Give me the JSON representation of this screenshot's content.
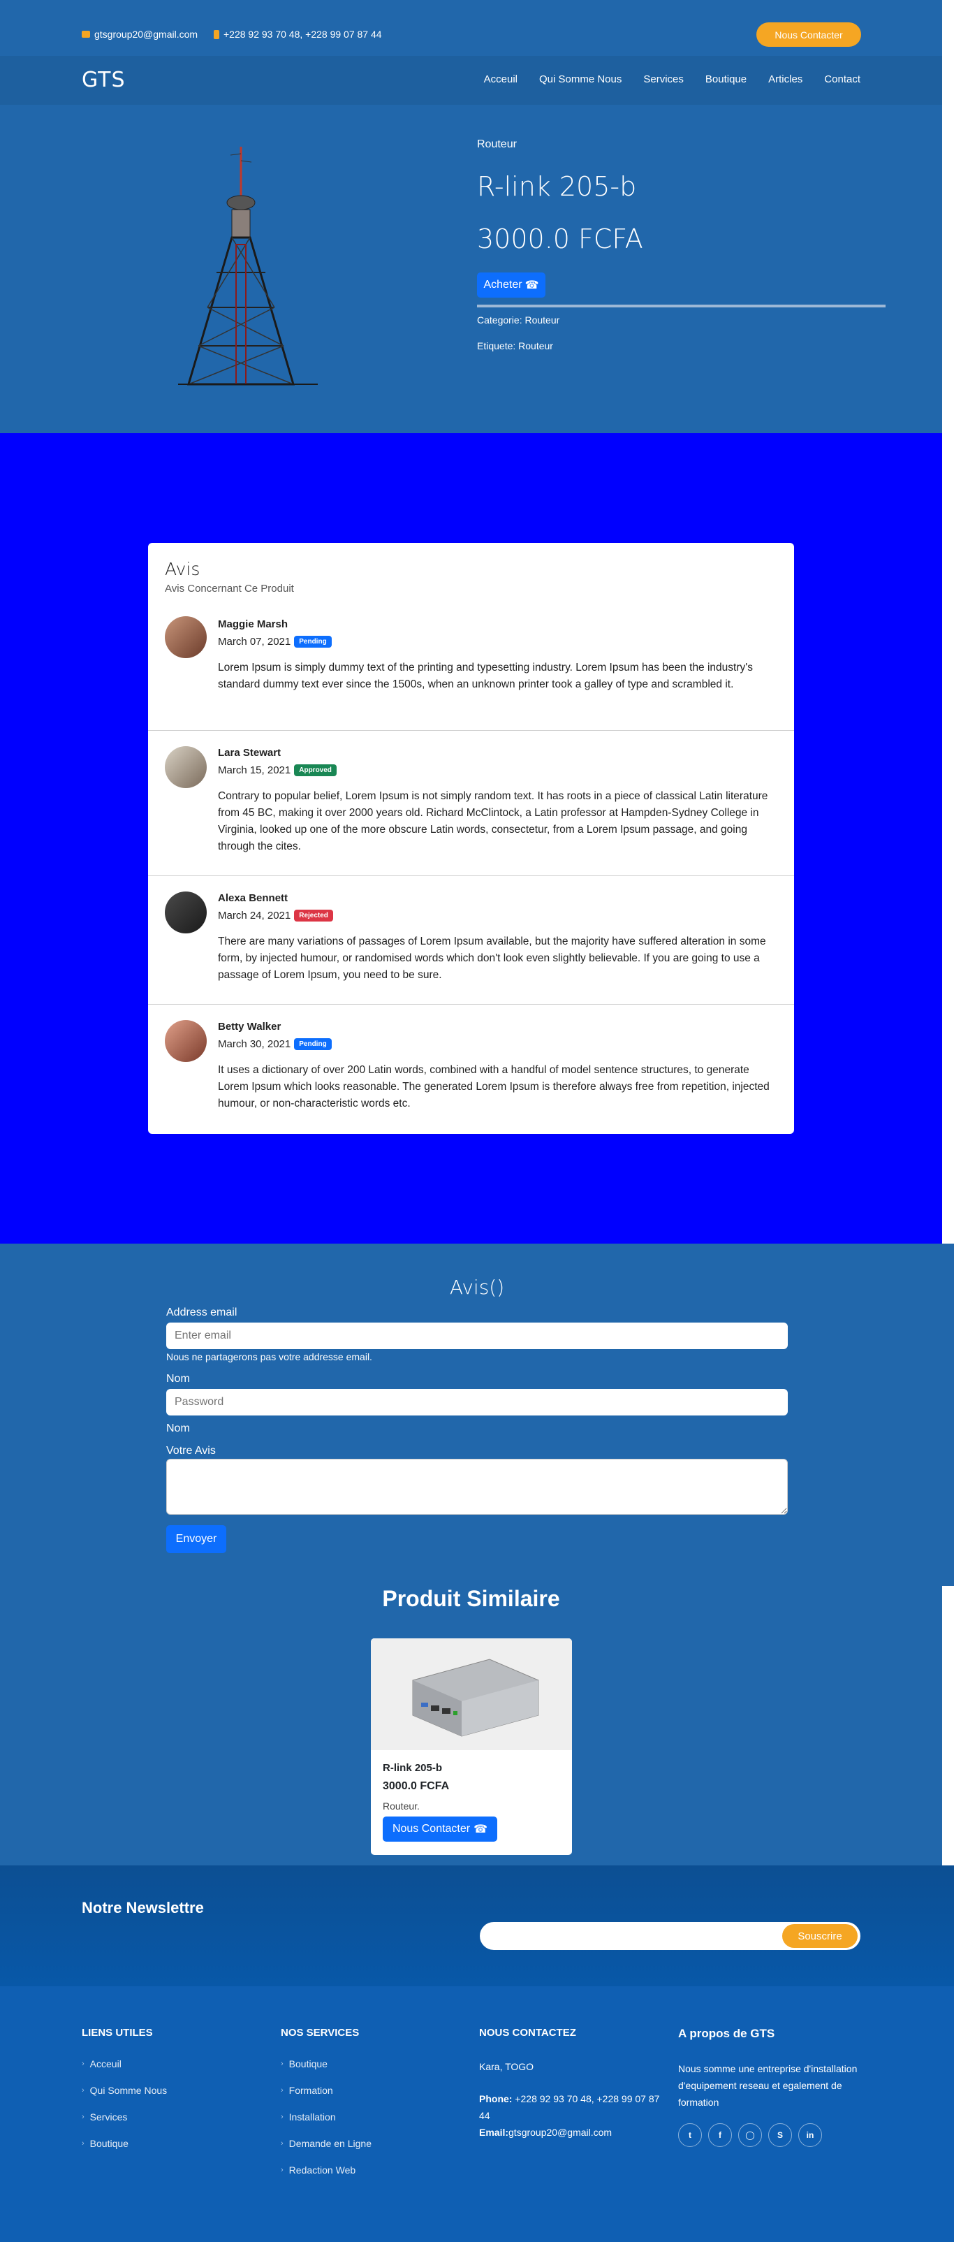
{
  "topbar": {
    "email": "gtsgroup20@gmail.com",
    "phone": "+228 92 93 70 48, +228 99 07 87 44",
    "cta": "Nous Contacter"
  },
  "nav": {
    "brand": "GTS",
    "links": [
      "Acceuil",
      "Qui Somme Nous",
      "Services",
      "Boutique",
      "Articles",
      "Contact"
    ]
  },
  "product": {
    "category": "Routeur",
    "name": "R-link 205-b",
    "price": "3000.0 FCFA",
    "buy_label": "Acheter",
    "category_line": "Categorie: Routeur",
    "tag_line": "Etiquete: Routeur"
  },
  "reviews": {
    "title": "Avis",
    "subtitle": "Avis Concernant Ce Produit",
    "items": [
      {
        "name": "Maggie Marsh",
        "date": "March 07, 2021",
        "status": "Pending",
        "text": "Lorem Ipsum is simply dummy text of the printing and typesetting industry. Lorem Ipsum has been the industry's standard dummy text ever since the 1500s, when an unknown printer took a galley of type and scrambled it."
      },
      {
        "name": "Lara Stewart",
        "date": "March 15, 2021",
        "status": "Approved",
        "text": "Contrary to popular belief, Lorem Ipsum is not simply random text. It has roots in a piece of classical Latin literature from 45 BC, making it over 2000 years old. Richard McClintock, a Latin professor at Hampden-Sydney College in Virginia, looked up one of the more obscure Latin words, consectetur, from a Lorem Ipsum passage, and going through the cites."
      },
      {
        "name": "Alexa Bennett",
        "date": "March 24, 2021",
        "status": "Rejected",
        "text": "There are many variations of passages of Lorem Ipsum available, but the majority have suffered alteration in some form, by injected humour, or randomised words which don't look even slightly believable. If you are going to use a passage of Lorem Ipsum, you need to be sure."
      },
      {
        "name": "Betty Walker",
        "date": "March 30, 2021",
        "status": "Pending",
        "text": "It uses a dictionary of over 200 Latin words, combined with a handful of model sentence structures, to generate Lorem Ipsum which looks reasonable. The generated Lorem Ipsum is therefore always free from repetition, injected humour, or non-characteristic words etc."
      }
    ]
  },
  "form": {
    "title": "Avis()",
    "email_label": "Address email",
    "email_placeholder": "Enter email",
    "email_help": "Nous ne partagerons pas votre addresse email.",
    "name_label": "Nom",
    "name_placeholder": "Password",
    "name_label2": "Nom",
    "review_label": "Votre Avis",
    "submit": "Envoyer"
  },
  "similar": {
    "title": "Produit Similaire",
    "product": {
      "name": "R-link 205-b",
      "price": "3000.0 FCFA",
      "category": "Routeur.",
      "button": "Nous Contacter"
    }
  },
  "newsletter": {
    "title": "Notre Newslettre",
    "button": "Souscrire"
  },
  "footer": {
    "useful": {
      "title": "LIENS UTILES",
      "items": [
        "Acceuil",
        "Qui Somme Nous",
        "Services",
        "Boutique"
      ]
    },
    "services": {
      "title": "NOS SERVICES",
      "items": [
        "Boutique",
        "Formation",
        "Installation",
        "Demande en Ligne",
        "Redaction Web"
      ]
    },
    "contact": {
      "title": "NOUS CONTACTEZ",
      "city": "Kara, TOGO",
      "phone_label": "Phone:",
      "phone": "+228 92 93 70 48, +228 99 07 87 44",
      "email_label": "Email:",
      "email": "gtsgroup20@gmail.com"
    },
    "about": {
      "title": "A propos de GTS",
      "text": "Nous somme une entreprise d'installation d'equipement reseau et egalement de formation",
      "socials": [
        "twitter-icon",
        "facebook-icon",
        "instagram-icon",
        "skype-icon",
        "linkedin-icon"
      ]
    }
  }
}
